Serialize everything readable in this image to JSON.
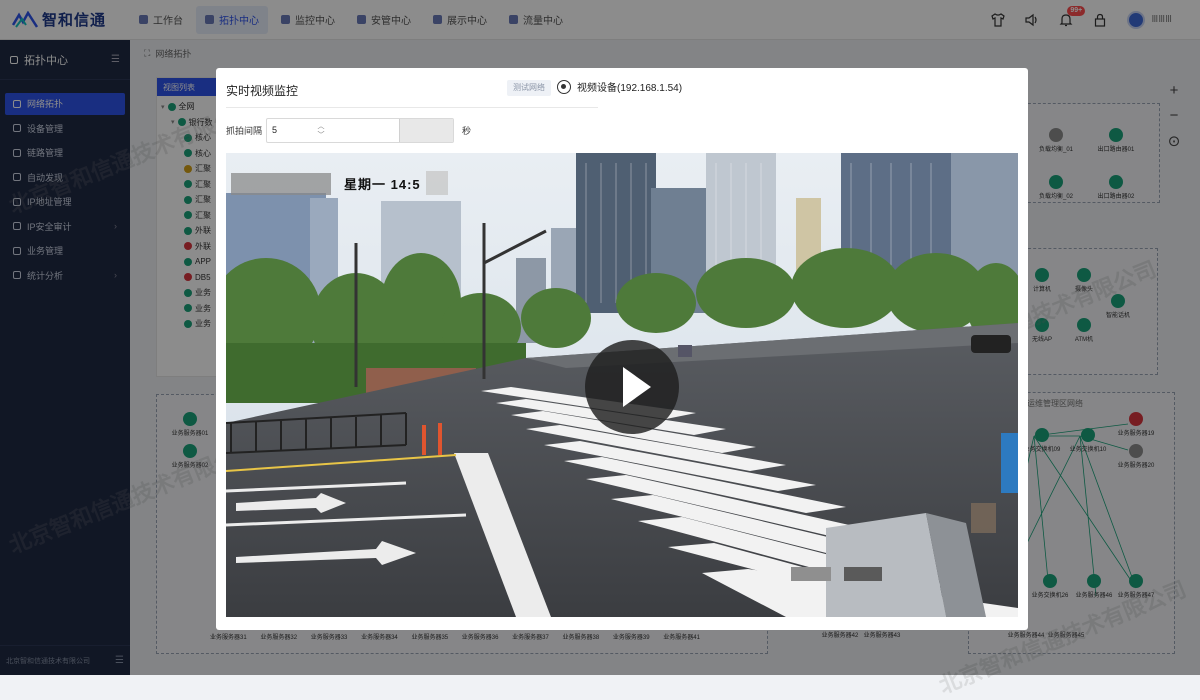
{
  "app": {
    "name": "智和信通",
    "company": "北京智和信通技术有限公司"
  },
  "topnav": [
    {
      "label": "工作台",
      "active": false
    },
    {
      "label": "拓扑中心",
      "active": true
    },
    {
      "label": "监控中心",
      "active": false
    },
    {
      "label": "安管中心",
      "active": false
    },
    {
      "label": "展示中心",
      "active": false
    },
    {
      "label": "流量中心",
      "active": false
    }
  ],
  "notifications": {
    "badge": "99+"
  },
  "user": {
    "name": "ⅢⅢⅢ"
  },
  "sidebar": {
    "title": "拓扑中心",
    "items": [
      {
        "label": "网络拓扑",
        "active": true,
        "expandable": false
      },
      {
        "label": "设备管理",
        "active": false,
        "expandable": false
      },
      {
        "label": "链路管理",
        "active": false,
        "expandable": false
      },
      {
        "label": "自动发现",
        "active": false,
        "expandable": false
      },
      {
        "label": "IP地址管理",
        "active": false,
        "expandable": false
      },
      {
        "label": "IP安全审计",
        "active": false,
        "expandable": true
      },
      {
        "label": "业务管理",
        "active": false,
        "expandable": false
      },
      {
        "label": "统计分析",
        "active": false,
        "expandable": true
      }
    ],
    "footer": "北京智和信通技术有限公司"
  },
  "breadcrumb": "网络拓扑",
  "view_panel": {
    "title": "视图列表",
    "tree": [
      {
        "label": "全网",
        "color": "#1aa27a",
        "level": 0
      },
      {
        "label": "银行数",
        "color": "#1aa27a",
        "level": 1
      },
      {
        "label": "核心",
        "color": "#1aa27a",
        "level": 2
      },
      {
        "label": "核心",
        "color": "#1aa27a",
        "level": 2
      },
      {
        "label": "汇聚",
        "color": "#d4a017",
        "level": 2
      },
      {
        "label": "汇聚",
        "color": "#1aa27a",
        "level": 2
      },
      {
        "label": "汇聚",
        "color": "#1aa27a",
        "level": 2
      },
      {
        "label": "汇聚",
        "color": "#1aa27a",
        "level": 2
      },
      {
        "label": "外联",
        "color": "#1aa27a",
        "level": 2
      },
      {
        "label": "外联",
        "color": "#d9363e",
        "level": 2
      },
      {
        "label": "APP",
        "color": "#1aa27a",
        "level": 2
      },
      {
        "label": "DB5",
        "color": "#d9363e",
        "level": 2
      },
      {
        "label": "业务",
        "color": "#1aa27a",
        "level": 2
      },
      {
        "label": "业务",
        "color": "#1aa27a",
        "level": 2
      },
      {
        "label": "业务",
        "color": "#1aa27a",
        "level": 2
      }
    ]
  },
  "topology": {
    "top_nodes": [
      "负载均衡_01",
      "出口路由器01",
      "负载均衡_02",
      "出口路由器02"
    ],
    "mid_nodes": [
      "计算机",
      "摄像头",
      "智能话机",
      "无线AP",
      "ATM机"
    ],
    "zone_title": "运维管理区网络",
    "zone_nodes": [
      "业务交换机09",
      "业务交换机10",
      "业务服务器19",
      "业务服务器20",
      "业务交换机26",
      "业务服务器46",
      "业务服务器47"
    ],
    "left_nodes": [
      "业务服务器01",
      "业务服务器02"
    ],
    "bottom_labels": [
      "业务服务器31",
      "业务服务器32",
      "业务服务器33",
      "业务服务器34",
      "业务服务器35",
      "业务服务器36",
      "业务服务器37",
      "业务服务器38",
      "业务服务器39",
      "业务服务器41"
    ],
    "bottom_right": [
      "业务服务器42",
      "业务服务器43",
      "业务服务器44",
      "业务服务器45"
    ]
  },
  "modal": {
    "title": "实时视频监控",
    "tag": "测试网络",
    "device": "视频设备(192.168.1.54)",
    "interval_label": "抓拍间隔",
    "interval_value": "5",
    "interval_unit": "秒",
    "osd_text": "星期一 14:5"
  },
  "icons": {
    "camera": "camera-icon",
    "play": "play-icon",
    "shirt": "tshirt-icon",
    "sound": "speaker-icon",
    "bell": "bell-icon",
    "lock": "lock-icon",
    "zoom_in": "plus-icon",
    "zoom_out": "minus-icon",
    "fit": "fit-icon"
  },
  "colors": {
    "accent": "#2f54eb",
    "sidebar": "#1f2a44",
    "online": "#1aa27a",
    "alert": "#d9363e"
  }
}
